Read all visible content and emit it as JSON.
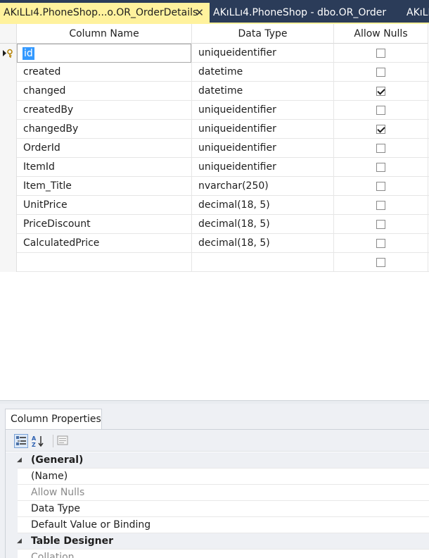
{
  "tabs": [
    {
      "label": "AKıLLı4.PhoneShop...o.OR_OrderDetails",
      "active": true,
      "close_glyph": "✕"
    },
    {
      "label": "AKıLLı4.PhoneShop - dbo.OR_Order",
      "active": false
    },
    {
      "label": "AKıLLı",
      "active": false
    }
  ],
  "grid": {
    "headers": {
      "name": "Column Name",
      "type": "Data Type",
      "nulls": "Allow Nulls"
    },
    "rows": [
      {
        "name": "id",
        "type": "uniqueidentifier",
        "allow_nulls": false,
        "primary_key": true,
        "editing": true
      },
      {
        "name": "created",
        "type": "datetime",
        "allow_nulls": false
      },
      {
        "name": "changed",
        "type": "datetime",
        "allow_nulls": true
      },
      {
        "name": "createdBy",
        "type": "uniqueidentifier",
        "allow_nulls": false
      },
      {
        "name": "changedBy",
        "type": "uniqueidentifier",
        "allow_nulls": true
      },
      {
        "name": "OrderId",
        "type": "uniqueidentifier",
        "allow_nulls": false
      },
      {
        "name": "ItemId",
        "type": "uniqueidentifier",
        "allow_nulls": false
      },
      {
        "name": "Item_Title",
        "type": "nvarchar(250)",
        "allow_nulls": false
      },
      {
        "name": "UnitPrice",
        "type": "decimal(18, 5)",
        "allow_nulls": false
      },
      {
        "name": "PriceDiscount",
        "type": "decimal(18, 5)",
        "allow_nulls": false
      },
      {
        "name": "CalculatedPrice",
        "type": "decimal(18, 5)",
        "allow_nulls": false
      },
      {
        "name": "",
        "type": "",
        "allow_nulls": false
      }
    ]
  },
  "properties": {
    "tab_label": "Column Properties",
    "toolbar": [
      "categorized-icon",
      "alphabetical-sort-icon",
      "property-pages-icon"
    ],
    "rows": [
      {
        "label": "(General)",
        "category": true
      },
      {
        "label": "(Name)"
      },
      {
        "label": "Allow Nulls",
        "disabled": true
      },
      {
        "label": "Data Type"
      },
      {
        "label": "Default Value or Binding"
      },
      {
        "label": "Table Designer",
        "category": true
      },
      {
        "label": "Collation",
        "disabled": true
      }
    ]
  },
  "colors": {
    "tab_bar": "#2b3c59",
    "active_tab": "#fff29d",
    "selection": "#3399ff"
  }
}
